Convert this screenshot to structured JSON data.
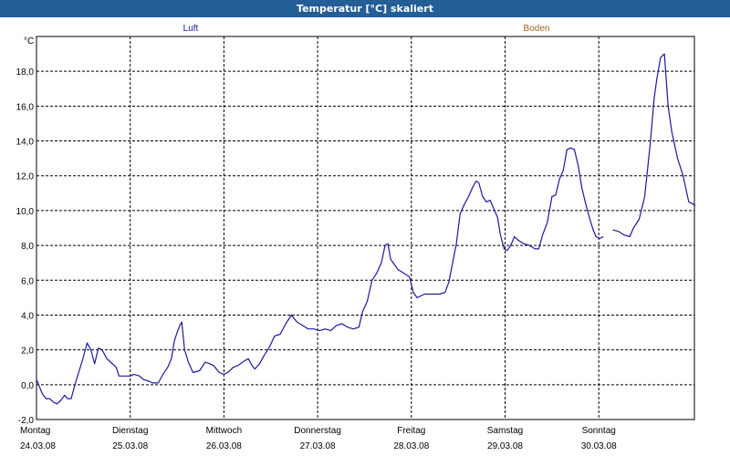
{
  "window": {
    "title": "Temperatur [°C] skaliert"
  },
  "colors": {
    "air": "#1a1a9c",
    "ground": "#a0641e",
    "grid": "#000000",
    "titlebar": "#245e96"
  },
  "chart_data": {
    "type": "line",
    "title": "Temperatur [°C] skaliert",
    "ylabel": "°C",
    "ylim": [
      -2.0,
      20.0
    ],
    "yticks": [
      "-2,0",
      "0,0",
      "2,0",
      "4,0",
      "6,0",
      "8,0",
      "10,0",
      "12,0",
      "14,0",
      "16,0",
      "18,0"
    ],
    "xlim": [
      0,
      7.0
    ],
    "x_gridlines": [
      1,
      2,
      3,
      4,
      5,
      6
    ],
    "grid": true,
    "legend": [
      "Luft",
      "Boden"
    ],
    "days": [
      {
        "day": "Montag",
        "date": "24.03.08"
      },
      {
        "day": "Dienstag",
        "date": "25.03.08"
      },
      {
        "day": "Mittwoch",
        "date": "26.03.08"
      },
      {
        "day": "Donnerstag",
        "date": "27.03.08"
      },
      {
        "day": "Freitag",
        "date": "28.03.08"
      },
      {
        "day": "Samstag",
        "date": "29.03.08"
      },
      {
        "day": "Sonntag",
        "date": "30.03.08"
      }
    ],
    "series": [
      {
        "name": "Luft",
        "segments": [
          [
            [
              0.0,
              0.3
            ],
            [
              0.06,
              -0.5
            ],
            [
              0.1,
              -0.8
            ],
            [
              0.14,
              -0.8
            ],
            [
              0.18,
              -1.0
            ],
            [
              0.22,
              -1.1
            ],
            [
              0.26,
              -0.9
            ],
            [
              0.3,
              -0.6
            ],
            [
              0.33,
              -0.8
            ],
            [
              0.37,
              -0.8
            ],
            [
              0.41,
              0.0
            ],
            [
              0.45,
              0.7
            ],
            [
              0.49,
              1.4
            ],
            [
              0.54,
              2.4
            ],
            [
              0.58,
              2.0
            ],
            [
              0.62,
              1.2
            ],
            [
              0.66,
              2.1
            ],
            [
              0.7,
              2.0
            ],
            [
              0.75,
              1.5
            ],
            [
              0.79,
              1.3
            ],
            [
              0.85,
              1.0
            ],
            [
              0.88,
              0.5
            ],
            [
              0.92,
              0.5
            ],
            [
              0.96,
              0.5
            ],
            [
              1.0,
              0.5
            ],
            [
              1.04,
              0.6
            ],
            [
              1.1,
              0.5
            ],
            [
              1.14,
              0.3
            ],
            [
              1.2,
              0.2
            ],
            [
              1.24,
              0.1
            ],
            [
              1.3,
              0.1
            ],
            [
              1.35,
              0.6
            ],
            [
              1.4,
              1.0
            ],
            [
              1.44,
              1.5
            ],
            [
              1.47,
              2.5
            ],
            [
              1.5,
              3.0
            ],
            [
              1.53,
              3.4
            ],
            [
              1.55,
              3.6
            ],
            [
              1.58,
              2.0
            ],
            [
              1.62,
              1.3
            ],
            [
              1.67,
              0.7
            ],
            [
              1.74,
              0.8
            ],
            [
              1.8,
              1.3
            ],
            [
              1.85,
              1.2
            ],
            [
              1.89,
              1.1
            ],
            [
              1.95,
              0.7
            ],
            [
              2.0,
              0.6
            ],
            [
              2.04,
              0.7
            ],
            [
              2.1,
              1.0
            ],
            [
              2.15,
              1.1
            ],
            [
              2.2,
              1.3
            ],
            [
              2.26,
              1.5
            ],
            [
              2.3,
              1.1
            ],
            [
              2.33,
              0.9
            ],
            [
              2.38,
              1.2
            ],
            [
              2.43,
              1.7
            ],
            [
              2.48,
              2.1
            ],
            [
              2.54,
              2.8
            ],
            [
              2.6,
              2.9
            ],
            [
              2.66,
              3.5
            ],
            [
              2.72,
              4.0
            ],
            [
              2.78,
              3.6
            ],
            [
              2.84,
              3.4
            ],
            [
              2.9,
              3.2
            ],
            [
              2.96,
              3.2
            ],
            [
              3.02,
              3.1
            ],
            [
              3.08,
              3.2
            ],
            [
              3.14,
              3.1
            ],
            [
              3.2,
              3.4
            ],
            [
              3.26,
              3.5
            ],
            [
              3.32,
              3.3
            ],
            [
              3.38,
              3.2
            ],
            [
              3.44,
              3.3
            ],
            [
              3.48,
              4.2
            ],
            [
              3.53,
              4.8
            ],
            [
              3.58,
              6.0
            ],
            [
              3.63,
              6.4
            ],
            [
              3.68,
              7.0
            ],
            [
              3.72,
              8.0
            ],
            [
              3.75,
              8.1
            ],
            [
              3.78,
              7.2
            ],
            [
              3.82,
              6.9
            ],
            [
              3.86,
              6.6
            ],
            [
              3.92,
              6.4
            ],
            [
              3.98,
              6.2
            ],
            [
              4.02,
              5.3
            ],
            [
              4.06,
              5.0
            ],
            [
              4.1,
              5.1
            ],
            [
              4.14,
              5.2
            ],
            [
              4.2,
              5.2
            ],
            [
              4.3,
              5.2
            ],
            [
              4.36,
              5.3
            ],
            [
              4.4,
              5.9
            ],
            [
              4.44,
              7.0
            ],
            [
              4.48,
              8.1
            ],
            [
              4.52,
              9.8
            ],
            [
              4.56,
              10.3
            ],
            [
              4.61,
              10.8
            ],
            [
              4.65,
              11.3
            ],
            [
              4.69,
              11.7
            ],
            [
              4.72,
              11.6
            ],
            [
              4.76,
              10.8
            ],
            [
              4.8,
              10.5
            ],
            [
              4.84,
              10.6
            ],
            [
              4.88,
              10.1
            ],
            [
              4.92,
              9.6
            ],
            [
              4.95,
              8.6
            ],
            [
              4.99,
              7.8
            ],
            [
              5.02,
              7.7
            ],
            [
              5.06,
              8.0
            ],
            [
              5.1,
              8.5
            ],
            [
              5.14,
              8.3
            ],
            [
              5.2,
              8.1
            ],
            [
              5.26,
              8.0
            ],
            [
              5.32,
              7.8
            ],
            [
              5.36,
              7.8
            ],
            [
              5.4,
              8.6
            ],
            [
              5.45,
              9.3
            ],
            [
              5.5,
              10.8
            ],
            [
              5.54,
              10.9
            ],
            [
              5.58,
              11.8
            ],
            [
              5.62,
              12.3
            ],
            [
              5.66,
              13.5
            ],
            [
              5.7,
              13.6
            ],
            [
              5.74,
              13.5
            ],
            [
              5.78,
              12.6
            ],
            [
              5.82,
              11.3
            ],
            [
              5.86,
              10.4
            ],
            [
              5.9,
              9.6
            ],
            [
              5.94,
              8.9
            ],
            [
              5.97,
              8.5
            ],
            [
              6.01,
              8.4
            ],
            [
              6.05,
              8.5
            ]
          ],
          [
            [
              6.15,
              8.9
            ],
            [
              6.21,
              8.8
            ],
            [
              6.27,
              8.6
            ],
            [
              6.33,
              8.5
            ],
            [
              6.37,
              9.0
            ],
            [
              6.43,
              9.5
            ],
            [
              6.49,
              10.8
            ],
            [
              6.55,
              13.9
            ],
            [
              6.59,
              16.4
            ],
            [
              6.62,
              17.6
            ],
            [
              6.66,
              18.8
            ],
            [
              6.7,
              19.0
            ],
            [
              6.74,
              16.0
            ],
            [
              6.78,
              14.5
            ],
            [
              6.84,
              13.0
            ],
            [
              6.9,
              12.0
            ],
            [
              6.96,
              10.5
            ],
            [
              7.0,
              10.4
            ],
            [
              7.03,
              10.3
            ]
          ]
        ]
      }
    ]
  }
}
